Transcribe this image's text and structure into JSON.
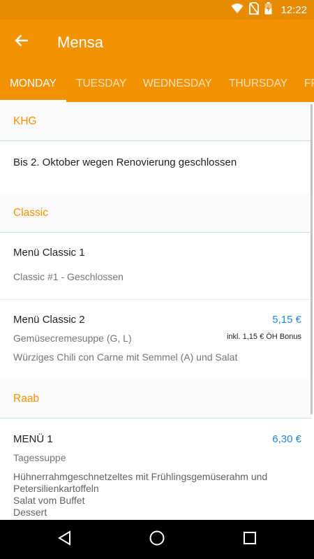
{
  "status_bar": {
    "time": "12:22",
    "icons": [
      "wifi-icon",
      "no-sim-icon",
      "battery-charging-icon"
    ]
  },
  "app_bar": {
    "title": "Mensa",
    "back_icon": "arrow-back-icon"
  },
  "tabs": [
    {
      "label": "MONDAY",
      "active": true
    },
    {
      "label": "TUESDAY",
      "active": false
    },
    {
      "label": "WEDNESDAY",
      "active": false
    },
    {
      "label": "THURSDAY",
      "active": false
    },
    {
      "label": "FR",
      "active": false
    }
  ],
  "sections": [
    {
      "name": "KHG",
      "items": [
        {
          "title": "Bis 2. Oktober wegen Renovierung geschlossen"
        }
      ]
    },
    {
      "name": "Classic",
      "items": [
        {
          "title": "Menü Classic 1",
          "desc": "Classic #1 - Geschlossen"
        },
        {
          "title": "Menü Classic 2",
          "price": "5,15 €",
          "bonus": "inkl. 1,15 € ÖH Bonus",
          "desc1": "Gemüsecremesuppe (G, L)",
          "desc2": "Würziges Chili con Carne mit Semmel (A) und Salat"
        }
      ]
    },
    {
      "name": "Raab",
      "items": [
        {
          "title": "MENÜ 1",
          "price": "6,30 €",
          "desc1": "Tagessuppe",
          "desc2_line1": "Hühnerrahmgeschnetzeltes mit Frühlingsgemüserahm und",
          "desc2_line2": "Petersilienkartoffeln",
          "desc2_line3": "Salat vom Buffet",
          "desc2_line4": "Dessert"
        }
      ]
    }
  ],
  "nav_bar": {
    "back": "nav-back-icon",
    "home": "nav-home-icon",
    "recents": "nav-recents-icon"
  },
  "colors": {
    "primary": "#f39200",
    "primary_dark": "#e68a00",
    "price": "#1e88e5"
  }
}
